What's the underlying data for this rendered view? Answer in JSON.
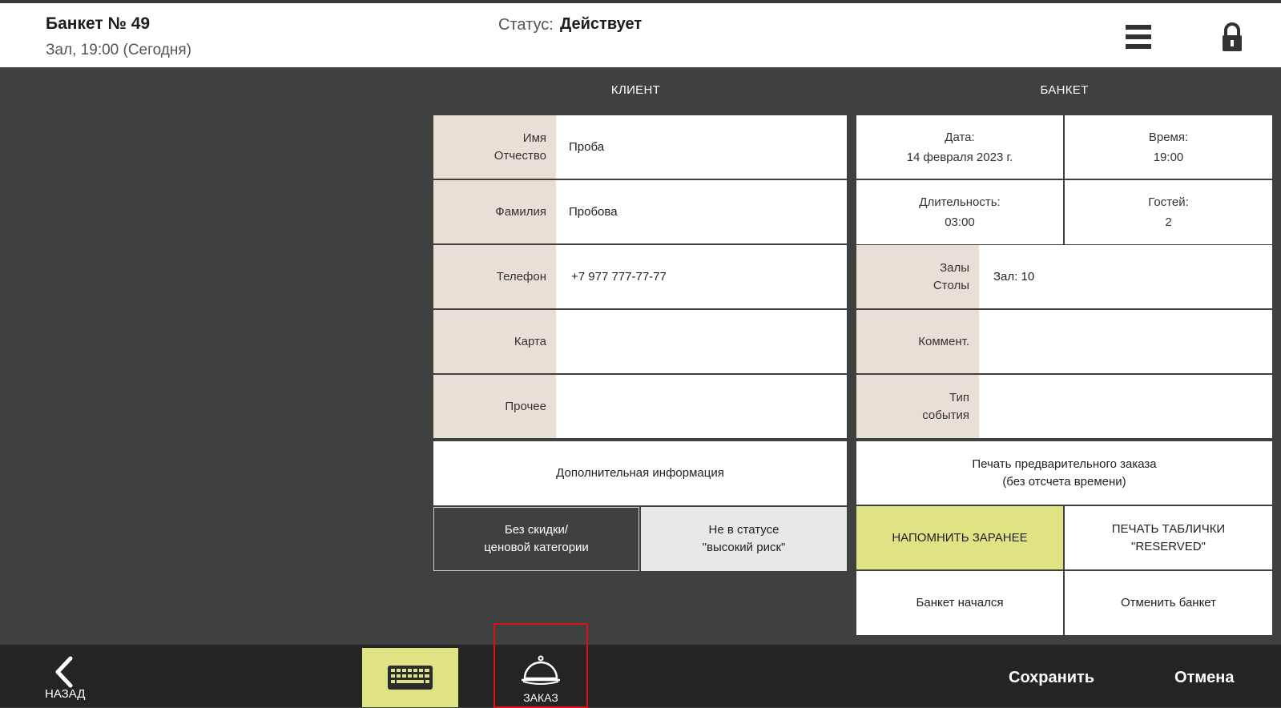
{
  "header": {
    "title": "Банкет № 49",
    "subtitle": "Зал, 19:00 (Сегодня)",
    "status_label": "Статус:",
    "status_value": "Действует",
    "menu_icon": "hamburger-menu-icon",
    "lock_icon": "lock-icon"
  },
  "client": {
    "title": "КЛИЕНТ",
    "fields": [
      {
        "label": "Имя\nОтчество",
        "value": "Проба"
      },
      {
        "label": "Фамилия",
        "value": "Пробова"
      },
      {
        "label": "Телефон",
        "value": "+7 977 777-77-77"
      },
      {
        "label": "Карта",
        "value": ""
      },
      {
        "label": "Прочее",
        "value": ""
      }
    ],
    "additional_info": "Дополнительная информация",
    "discount_button": "Без скидки/\nценовой категории",
    "risk_button": "Не в статусе\n\"высокий риск\""
  },
  "banquet": {
    "title": "БАНКЕТ",
    "date_label": "Дата:",
    "date_value": "14 февраля 2023 г.",
    "time_label": "Время:",
    "time_value": "19:00",
    "duration_label": "Длительность:",
    "duration_value": "03:00",
    "guests_label": "Гостей:",
    "guests_value": "2",
    "halls_label": "Залы\nСтолы",
    "halls_value": "Зал: 10",
    "comment_label": "Коммент.",
    "comment_value": "",
    "event_type_label": "Тип\nсобытия",
    "event_type_value": "",
    "print_preorder": "Печать предварительного заказа\n(без отсчета времени)",
    "remind_button": "НАПОМНИТЬ ЗАРАНЕЕ",
    "print_reserved": "ПЕЧАТЬ ТАБЛИЧКИ\n\"RESERVED\"",
    "started_button": "Банкет начался",
    "cancel_banquet": "Отменить банкет"
  },
  "footer": {
    "back_label": "НАЗАД",
    "keyboard_icon": "keyboard-icon",
    "order_label": "ЗАКАЗ",
    "order_icon": "cloche-icon",
    "save_label": "Сохранить",
    "cancel_label": "Отмена"
  },
  "colors": {
    "background": "#3f4140",
    "label_bg": "#e8dfd7",
    "accent": "#dfe383",
    "footer": "#232423",
    "highlight_border": "#e01010"
  }
}
